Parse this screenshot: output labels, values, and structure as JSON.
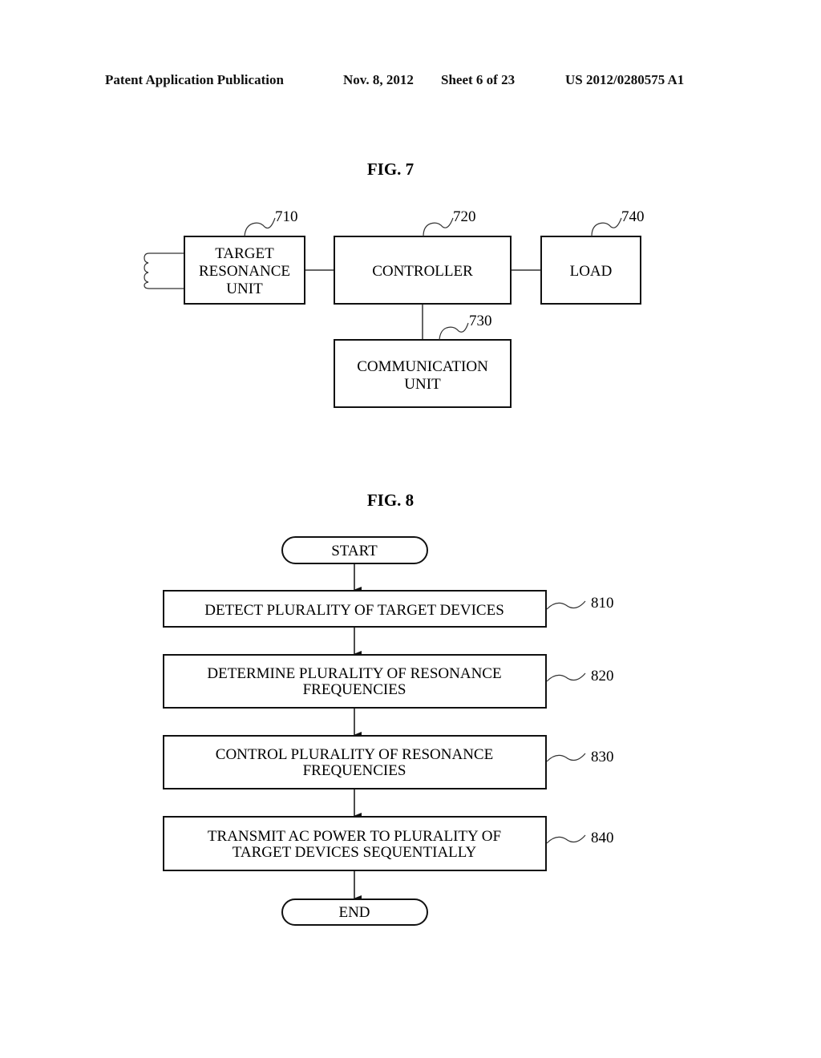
{
  "header": {
    "publication": "Patent Application Publication",
    "date": "Nov. 8, 2012",
    "sheet": "Sheet 6 of 23",
    "pub_number": "US 2012/0280575 A1"
  },
  "fig7": {
    "title": "FIG. 7",
    "blocks": {
      "target_resonance_unit": {
        "ref": "710",
        "lines": [
          "TARGET",
          "RESONANCE",
          "UNIT"
        ]
      },
      "controller": {
        "ref": "720",
        "lines": [
          "CONTROLLER"
        ]
      },
      "communication_unit": {
        "ref": "730",
        "lines": [
          "COMMUNICATION",
          "UNIT"
        ]
      },
      "load": {
        "ref": "740",
        "lines": [
          "LOAD"
        ]
      }
    },
    "connections": [
      [
        "target_resonance_unit",
        "controller"
      ],
      [
        "controller",
        "load"
      ],
      [
        "controller",
        "communication_unit"
      ]
    ]
  },
  "fig8": {
    "title": "FIG. 8",
    "start": "START",
    "end": "END",
    "steps": [
      {
        "ref": "810",
        "lines": [
          "DETECT PLURALITY OF TARGET DEVICES"
        ]
      },
      {
        "ref": "820",
        "lines": [
          "DETERMINE PLURALITY OF RESONANCE",
          "FREQUENCIES"
        ]
      },
      {
        "ref": "830",
        "lines": [
          "CONTROL PLURALITY OF RESONANCE",
          "FREQUENCIES"
        ]
      },
      {
        "ref": "840",
        "lines": [
          "TRANSMIT AC POWER TO PLURALITY OF",
          "TARGET DEVICES SEQUENTIALLY"
        ]
      }
    ]
  }
}
